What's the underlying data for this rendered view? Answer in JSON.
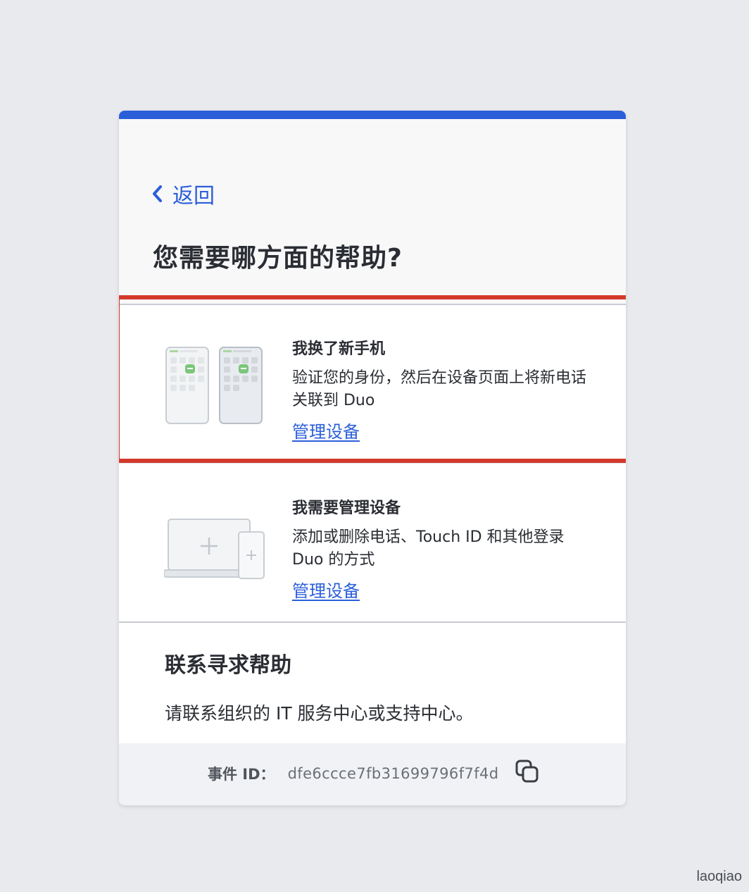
{
  "back": {
    "label": "返回"
  },
  "page": {
    "title": "您需要哪方面的帮助?"
  },
  "options": [
    {
      "title": "我换了新手机",
      "description": "验证您的身份，然后在设备页面上将新电话关联到 Duo",
      "link": "管理设备",
      "icon": "new-phones-illustration"
    },
    {
      "title": "我需要管理设备",
      "description": "添加或删除电话、Touch ID 和其他登录 Duo 的方式",
      "link": "管理设备",
      "icon": "laptop-phone-add-illustration"
    }
  ],
  "contact": {
    "title": "联系寻求帮助",
    "description": "请联系组织的 IT 服务中心或支持中心。"
  },
  "footer": {
    "event_label": "事件 ID：",
    "event_id": "dfe6ccce7fb31699796f7f4d",
    "copy_icon": "copy-icon"
  },
  "watermark": "laoqiao",
  "colors": {
    "accent": "#2b5fd9",
    "highlight": "#d33a2c",
    "background": "#e9eaee"
  }
}
